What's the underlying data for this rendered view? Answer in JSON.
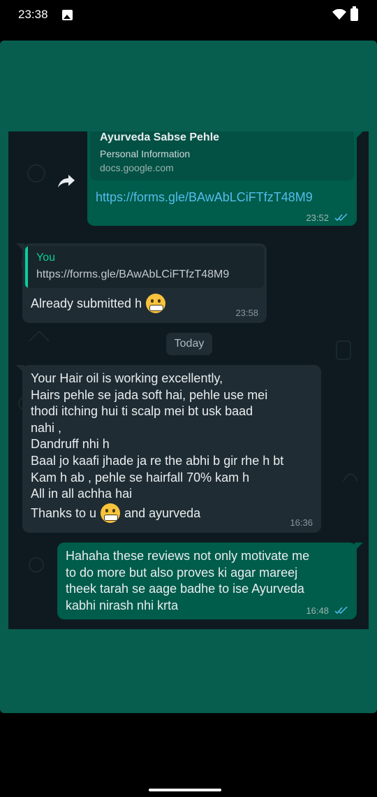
{
  "status_bar": {
    "time": "23:38",
    "icons": [
      "image-icon",
      "wifi-icon",
      "battery-icon"
    ]
  },
  "chat": {
    "messages": [
      {
        "direction": "outgoing",
        "link_preview": {
          "title": "Ayurveda Sabse Pehle",
          "subtitle": "Personal Information",
          "domain": "docs.google.com"
        },
        "link": "https://forms.gle/BAwAbLCiFTfzT48M9",
        "time": "23:52",
        "status": "read"
      },
      {
        "direction": "incoming",
        "quote": {
          "author": "You",
          "text": "https://forms.gle/BAwAbLCiFTfzT48M9"
        },
        "text": "Already submitted h",
        "emoji": "grimacing-face",
        "time": "23:58"
      },
      {
        "direction": "incoming",
        "lines": [
          "Your Hair oil is working excellently,",
          "Hairs pehle se jada soft hai, pehle use mei",
          "thodi itching hui ti scalp mei bt usk baad",
          "nahi ,",
          "Dandruff nhi h",
          "Baal jo kaafi jhade ja re the abhi b gir rhe h bt",
          "Kam h ab , pehle se hairfall 70% kam h",
          "All in all achha hai"
        ],
        "last_line_before": "Thanks to u",
        "last_line_after": "and ayurveda",
        "emoji": "grimacing-face",
        "time": "16:36"
      },
      {
        "direction": "outgoing",
        "lines": [
          "Hahaha these reviews not only motivate me",
          "to do more but also proves ki agar mareej",
          "theek tarah se aage badhe to ise Ayurveda",
          "kabhi nirash nhi krta"
        ],
        "time": "16:48",
        "status": "read"
      }
    ],
    "date_divider": "Today"
  },
  "colors": {
    "frame": "#075e4f",
    "chat_bg": "#0e1a1f",
    "outgoing": "#005c4b",
    "incoming": "#1f2c33",
    "link": "#53bdeb",
    "read_ticks": "#53bdeb"
  }
}
